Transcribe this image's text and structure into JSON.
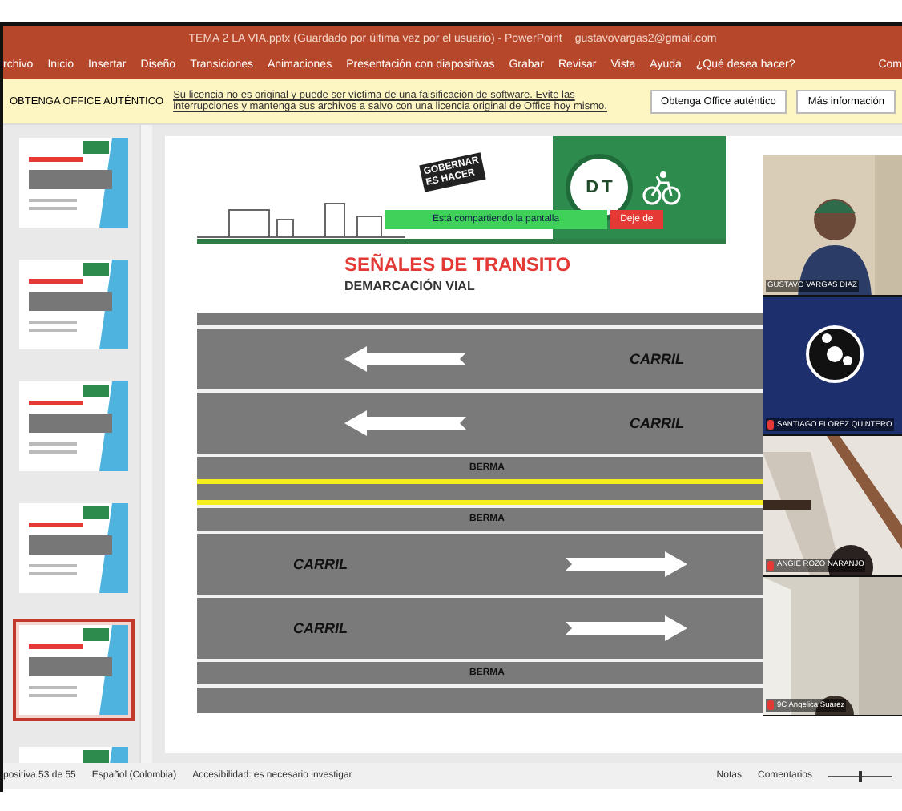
{
  "title_bar": {
    "title": "TEMA 2 LA VIA.pptx (Guardado por última vez por el usuario) - PowerPoint",
    "account": "gustavovargas2@gmail.com"
  },
  "ribbon": {
    "tabs": [
      "rchivo",
      "Inicio",
      "Insertar",
      "Diseño",
      "Transiciones",
      "Animaciones",
      "Presentación con diapositivas",
      "Grabar",
      "Revisar",
      "Vista",
      "Ayuda"
    ],
    "search": "¿Qué desea hacer?",
    "share": "Com"
  },
  "notice": {
    "label": "OBTENGA OFFICE AUTÉNTICO",
    "message": "Su licencia no es original y puede ser víctima de una falsificación de software. Evite las interrupciones y mantenga sus archivos a salvo con una licencia original de Office hoy mismo.",
    "buttons": [
      "Obtenga Office auténtico",
      "Más información"
    ]
  },
  "thumbnails": [
    {
      "selected": false
    },
    {
      "selected": false
    },
    {
      "selected": false
    },
    {
      "selected": false
    },
    {
      "selected": true
    },
    {
      "selected": false
    }
  ],
  "slide": {
    "badge": [
      "GOBERNAR",
      "ES HACER"
    ],
    "emblem": [
      "D",
      "T"
    ],
    "share_bar": {
      "text": "Está compartiendo la pantalla",
      "stop": "Deje de"
    },
    "title": "SEÑALES DE TRANSITO",
    "subtitle": "DEMARCACIÓN VIAL",
    "road": [
      {
        "kind": "westbound",
        "label": "CARRIL"
      },
      {
        "kind": "westbound",
        "label": "CARRIL"
      },
      {
        "kind": "shoulder",
        "label": "BERMA"
      },
      {
        "kind": "center_line"
      },
      {
        "kind": "shoulder",
        "label": "BERMA"
      },
      {
        "kind": "eastbound",
        "label": "CARRIL"
      },
      {
        "kind": "eastbound",
        "label": "CARRIL"
      },
      {
        "kind": "shoulder",
        "label": "BERMA"
      }
    ]
  },
  "participants": [
    {
      "name": "GUSTAVO VARGAS DIAZ",
      "kind": "camera",
      "muted": false
    },
    {
      "name": "SANTIAGO FLOREZ QUINTERO",
      "kind": "logo",
      "muted": true
    },
    {
      "name": "ANGIE ROZO NARANJO",
      "kind": "stairs",
      "muted": true
    },
    {
      "name": "9C Angelica Suarez",
      "kind": "room",
      "muted": true
    }
  ],
  "status_bar": {
    "slide": "positiva 53 de 55",
    "language": "Español (Colombia)",
    "accessibility": "Accesibilidad: es necesario investigar",
    "notes": "Notas",
    "comments": "Comentarios",
    "zoom": {
      "level": 0.5
    }
  }
}
